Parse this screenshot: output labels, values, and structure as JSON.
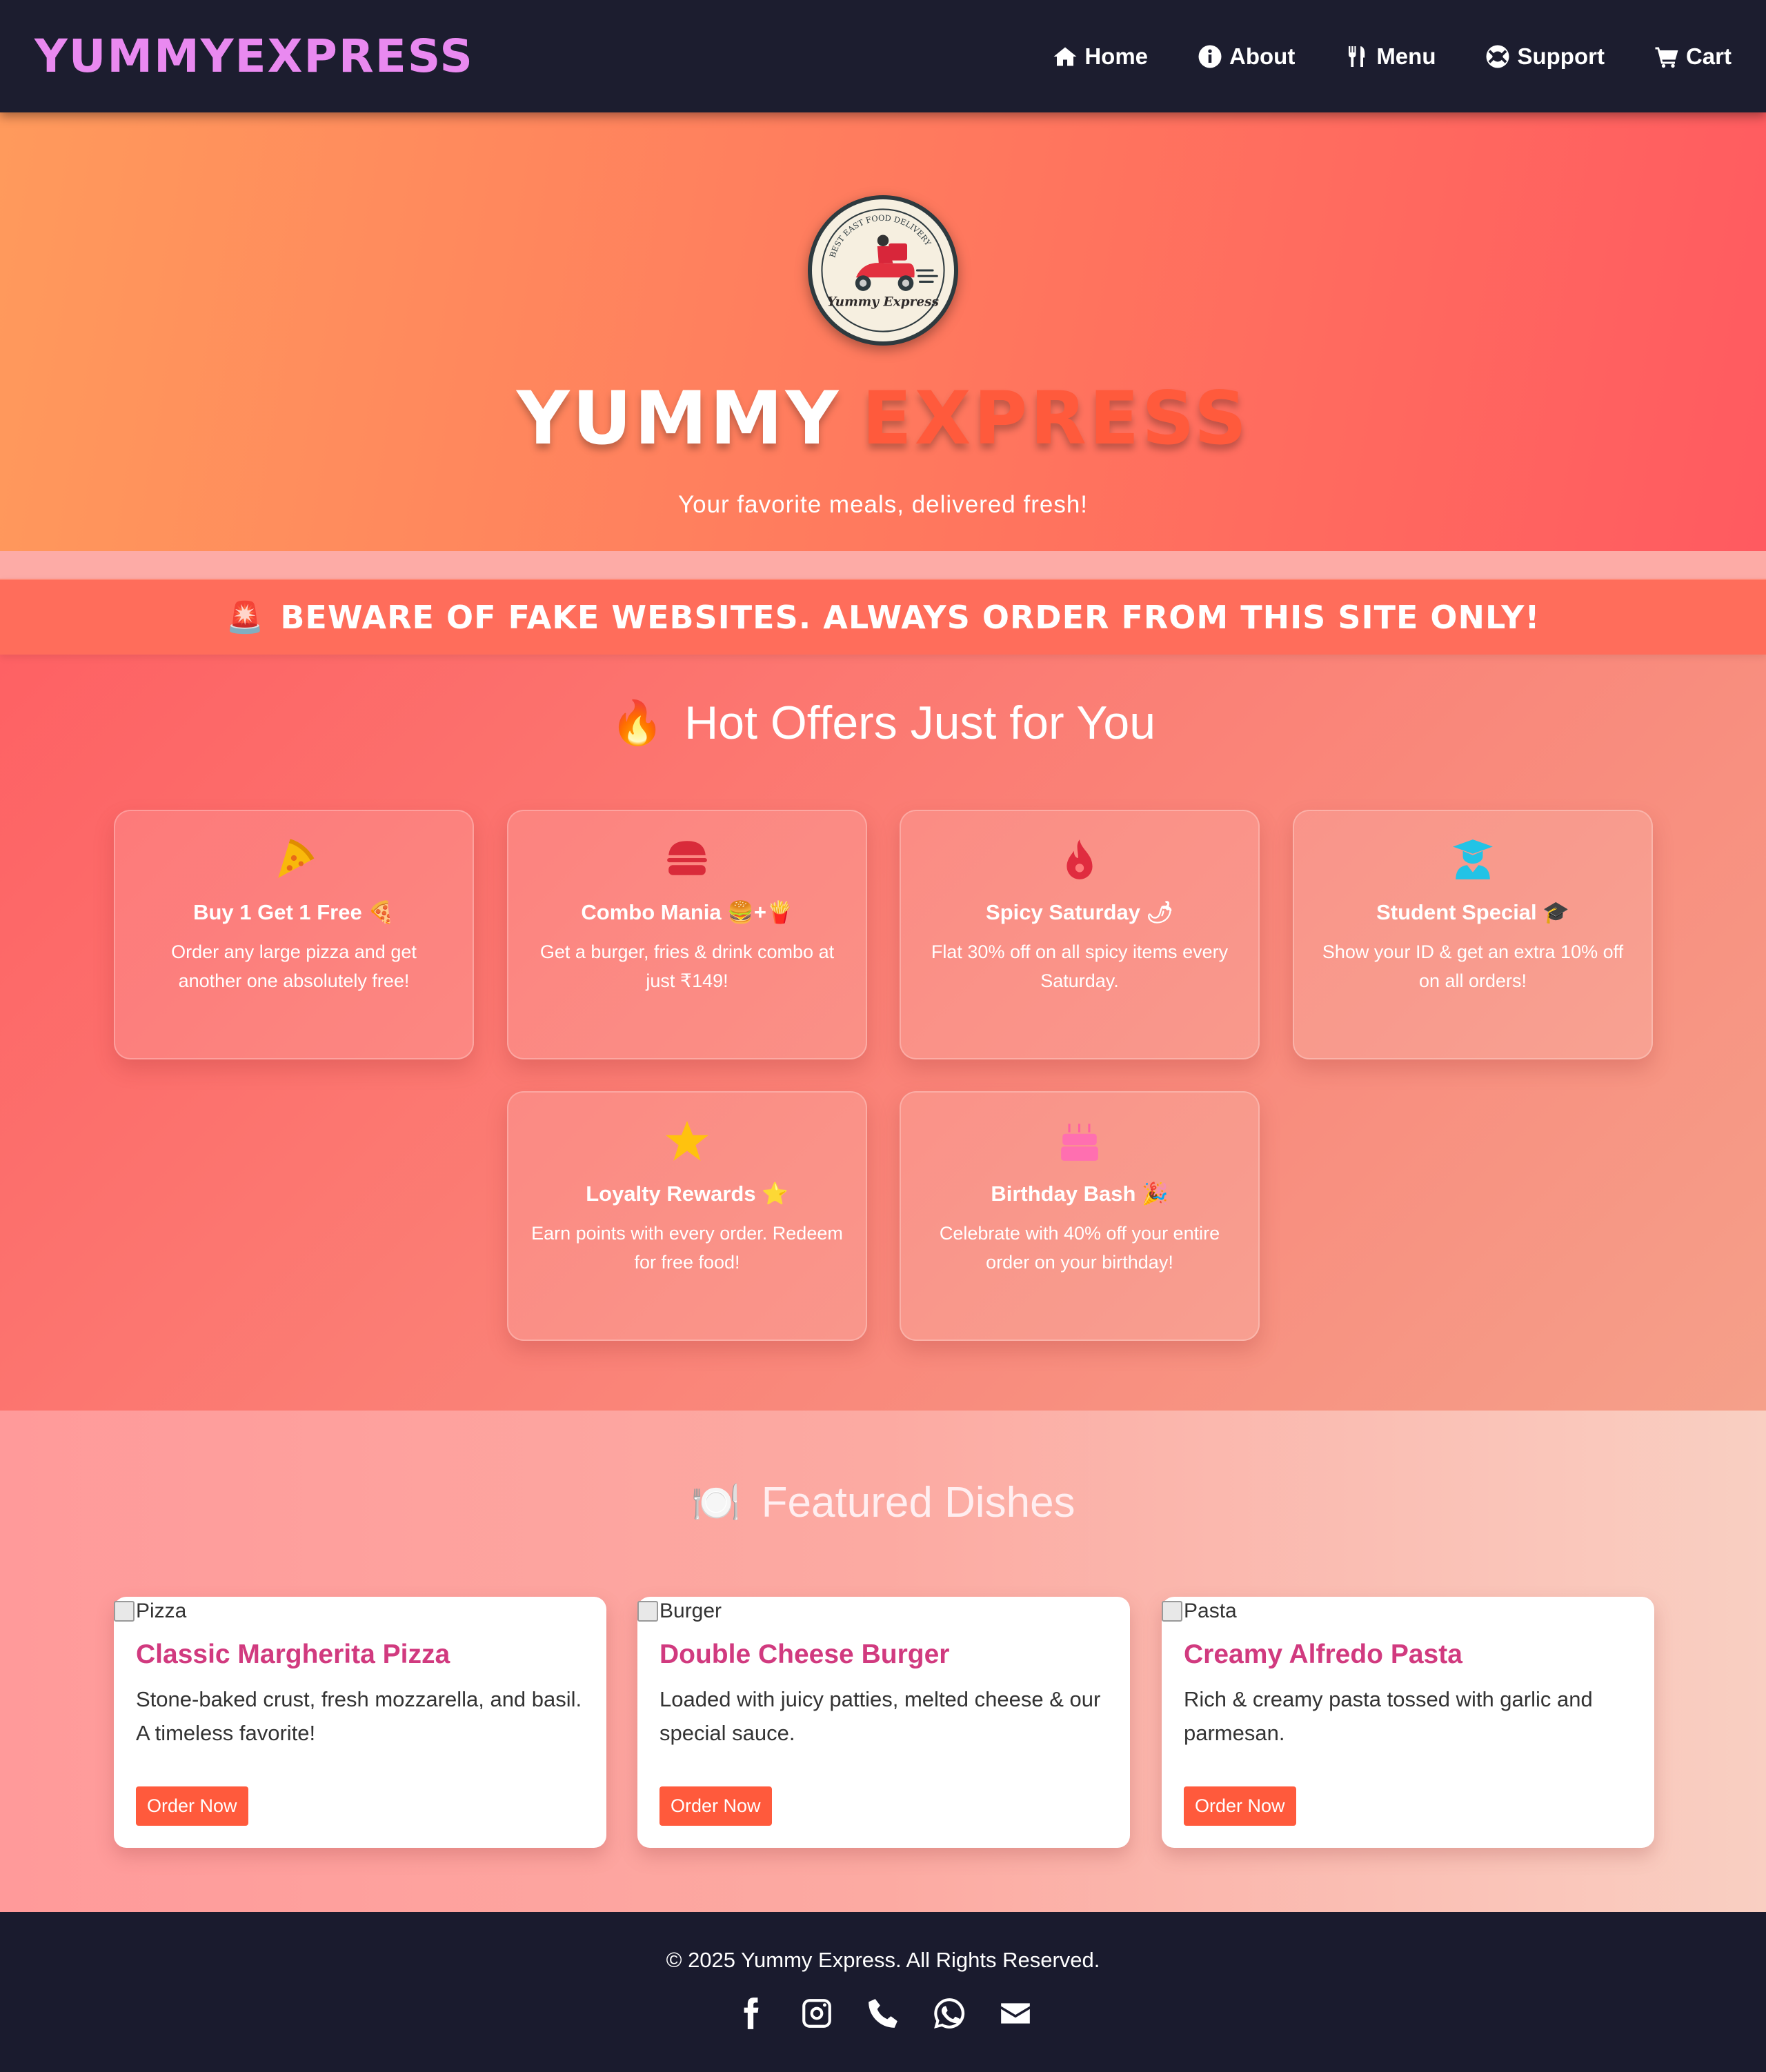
{
  "navbar": {
    "brand": "YUMMYEXPRESS",
    "links": [
      {
        "label": "Home",
        "icon": "home-icon"
      },
      {
        "label": "About",
        "icon": "info-icon"
      },
      {
        "label": "Menu",
        "icon": "utensils-icon"
      },
      {
        "label": "Support",
        "icon": "lifebuoy-icon"
      },
      {
        "label": "Cart",
        "icon": "cart-icon"
      }
    ]
  },
  "hero": {
    "logo_text_top": "BEST EAST FOOD DELIVERY",
    "logo_text_bottom": "Yummy Express",
    "title_word1": "YUMMY",
    "title_word2": "EXPRESS",
    "subtitle": "Your favorite meals, delivered fresh!"
  },
  "warning": {
    "icon": "🚨",
    "text": "BEWARE OF FAKE WEBSITES. ALWAYS ORDER FROM THIS SITE ONLY!"
  },
  "offers": {
    "title_icon": "🔥",
    "title": "Hot Offers Just for You",
    "cards": [
      {
        "icon": "pizza-icon",
        "title": "Buy 1 Get 1 Free 🍕",
        "text": "Order any large pizza and get another one absolutely free!"
      },
      {
        "icon": "burger-icon",
        "title": "Combo Mania 🍔+🍟",
        "text": "Get a burger, fries & drink combo at just ₹149!"
      },
      {
        "icon": "flame-icon",
        "title": "Spicy Saturday 🌶",
        "text": "Flat 30% off on all spicy items every Saturday."
      },
      {
        "icon": "graduate-icon",
        "title": "Student Special 🎓",
        "text": "Show your ID & get an extra 10% off on all orders!"
      },
      {
        "icon": "star-icon",
        "title": "Loyalty Rewards ⭐",
        "text": "Earn points with every order. Redeem for free food!"
      },
      {
        "icon": "cake-icon",
        "title": "Birthday Bash 🎉",
        "text": "Celebrate with 40% off your entire order on your birthday!"
      }
    ]
  },
  "featured": {
    "title_icon": "🍽️",
    "title": "Featured Dishes",
    "dishes": [
      {
        "alt": "Pizza",
        "name": "Classic Margherita Pizza",
        "desc": "Stone-baked crust, fresh mozzarella, and basil. A timeless favorite!",
        "button": "Order Now"
      },
      {
        "alt": "Burger",
        "name": "Double Cheese Burger",
        "desc": "Loaded with juicy patties, melted cheese & our special sauce.",
        "button": "Order Now"
      },
      {
        "alt": "Pasta",
        "name": "Creamy Alfredo Pasta",
        "desc": "Rich & creamy pasta tossed with garlic and parmesan.",
        "button": "Order Now"
      }
    ]
  },
  "footer": {
    "copyright": "© 2025 Yummy Express. All Rights Reserved.",
    "socials": [
      "facebook-icon",
      "instagram-icon",
      "phone-icon",
      "whatsapp-icon",
      "email-icon"
    ]
  },
  "colors": {
    "nav_bg": "#1c1d2f",
    "brand": "#e989f0",
    "accent": "#ff5a3c",
    "dish_title": "#d13a7f"
  }
}
